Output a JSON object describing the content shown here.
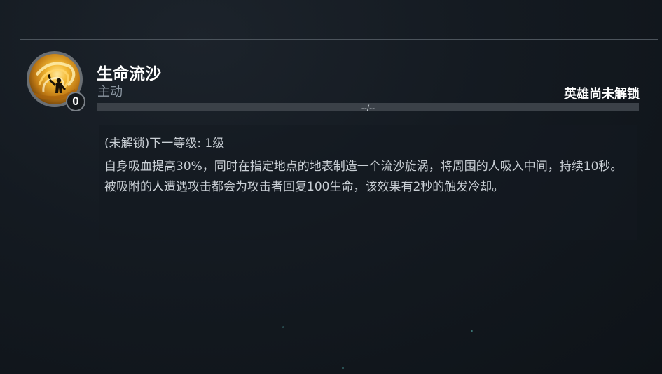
{
  "skill": {
    "name": "生命流沙",
    "type": "主动",
    "level": "0",
    "icon": "sand-vortex-icon",
    "lock_status": "英雄尚未解锁",
    "progress_text": "--/--",
    "next_level": "(未解锁)下一等级: 1级",
    "description": "自身吸血提高30%，同时在指定地点的地表制造一个流沙旋涡，将周围的人吸入中间，持续10秒。被吸附的人遭遇攻击都会为攻击者回复100生命，该效果有2秒的触发冷却。"
  },
  "colors": {
    "background": "#141a21",
    "title": "#ffffff",
    "subtitle": "#8b96a1",
    "body_text": "#c9cfd5",
    "progress_track": "#3b4148",
    "icon_gold": "#f3b934"
  }
}
